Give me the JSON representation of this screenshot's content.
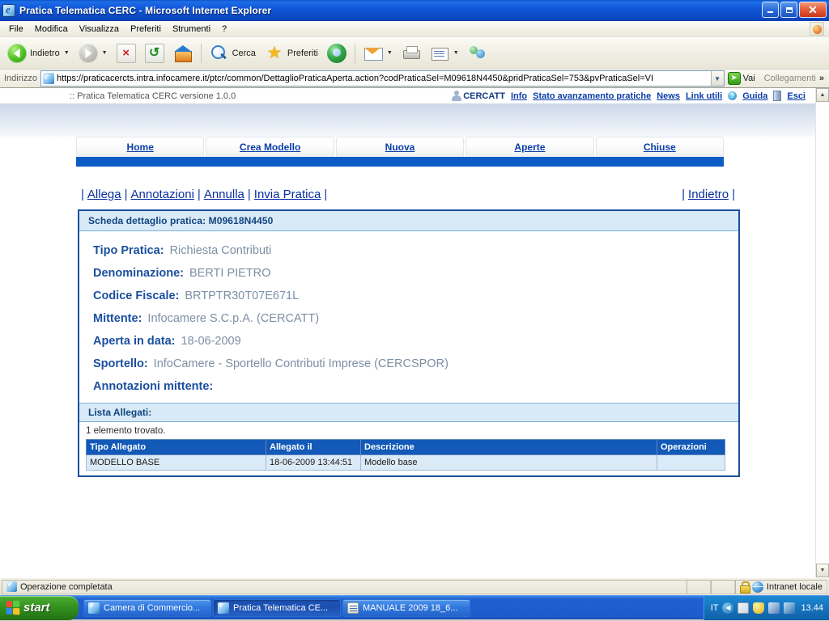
{
  "window": {
    "title": "Pratica Telematica CERC - Microsoft Internet Explorer",
    "minimize_label": "Riduci a icona",
    "restore_label": "Ripristina",
    "close_label": "Chiudi"
  },
  "menu": {
    "items": [
      "File",
      "Modifica",
      "Visualizza",
      "Preferiti",
      "Strumenti",
      "?"
    ]
  },
  "toolbar": {
    "back": "Indietro",
    "search": "Cerca",
    "favorites": "Preferiti"
  },
  "address": {
    "label": "Indirizzo",
    "url": "https://praticacercts.intra.infocamere.it/ptcr/common/DettaglioPraticaAperta.action?codPraticaSel=M09618N4450&pridPraticaSel=753&pvPraticaSel=VI",
    "go": "Vai",
    "links": "Collegamenti"
  },
  "page_header": {
    "version": ":: Pratica Telematica CERC versione 1.0.0",
    "user": "CERCATT",
    "links": [
      "Info",
      "Stato avanzamento pratiche",
      "News",
      "Link utili",
      "Guida",
      "Esci"
    ]
  },
  "tabs": [
    {
      "label": "Home"
    },
    {
      "label": "Crea Modello"
    },
    {
      "label": "Nuova"
    },
    {
      "label": "Aperte"
    },
    {
      "label": "Chiuse"
    }
  ],
  "actions": {
    "left": [
      "Allega",
      "Annotazioni",
      "Annulla",
      "Invia Pratica"
    ],
    "right": [
      "Indietro"
    ],
    "separator": "|"
  },
  "detail": {
    "panel_title": "Scheda dettaglio pratica: M09618N4450",
    "fields": [
      {
        "label": "Tipo Pratica:",
        "value": "Richiesta Contributi"
      },
      {
        "label": "Denominazione:",
        "value": "BERTI PIETRO"
      },
      {
        "label": "Codice Fiscale:",
        "value": "BRTPTR30T07E671L"
      },
      {
        "label": "Mittente:",
        "value": "Infocamere S.C.p.A. (CERCATT)"
      },
      {
        "label": "Aperta in data:",
        "value": "18-06-2009"
      },
      {
        "label": "Sportello:",
        "value": "InfoCamere - Sportello Contributi Imprese (CERCSPOR)"
      },
      {
        "label": "Annotazioni mittente:",
        "value": ""
      }
    ]
  },
  "attachments": {
    "section_title": "Lista Allegati:",
    "found_text": "1 elemento trovato.",
    "columns": [
      "Tipo Allegato",
      "Allegato il",
      "Descrizione",
      "Operazioni"
    ],
    "rows": [
      {
        "tipo": "MODELLO BASE",
        "allegato_il": "18-06-2009 13:44:51",
        "descrizione": "Modello base",
        "operazioni": ""
      }
    ]
  },
  "statusbar": {
    "message": "Operazione completata",
    "zone": "Intranet locale"
  },
  "taskbar": {
    "start": "start",
    "tasks": [
      {
        "label": "Camera di Commercio...",
        "icon": "ie-icon",
        "active": false
      },
      {
        "label": "Pratica Telematica CE...",
        "icon": "ie-icon",
        "active": true
      },
      {
        "label": "MANUALE 2009 18_6...",
        "icon": "doc-icon",
        "active": false
      }
    ],
    "tray": {
      "language": "IT",
      "clock": "13.44"
    }
  },
  "colors": {
    "title_blue": "#0b5cc4",
    "link_blue": "#0a3da8",
    "panel_border": "#1b4f9e",
    "panel_head_bg": "#d8eaf8",
    "table_header_bg": "#1259b8",
    "table_row_bg": "#dbeaf7",
    "field_value_gray": "#7d8fa4"
  }
}
